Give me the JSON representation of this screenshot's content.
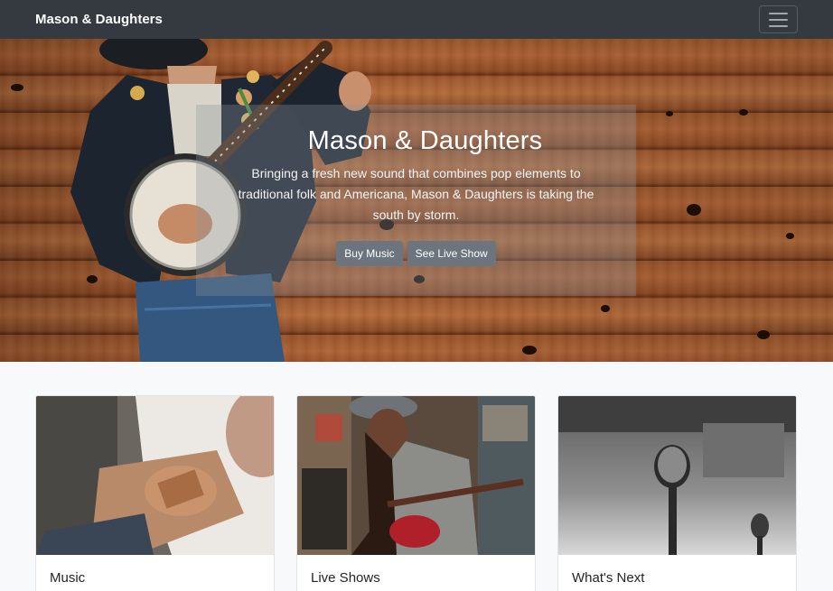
{
  "navbar": {
    "brand": "Mason & Daughters",
    "toggler_icon": "hamburger-icon"
  },
  "hero": {
    "title": "Mason & Daughters",
    "text": "Bringing a fresh new sound that combines pop elements to traditional folk and Americana, Mason & Daughters is taking the south by storm.",
    "buttons": [
      "Buy Music",
      "See Live Show"
    ]
  },
  "cards": [
    {
      "title": "Music",
      "image": "guitarist-photo"
    },
    {
      "title": "Live Shows",
      "image": "woman-guitar-record-store-photo"
    },
    {
      "title": "What's Next",
      "image": "microphone-photo"
    }
  ],
  "colors": {
    "navbar": "#343a40",
    "button": "#6c757d",
    "page_background": "#f8f9fa"
  }
}
